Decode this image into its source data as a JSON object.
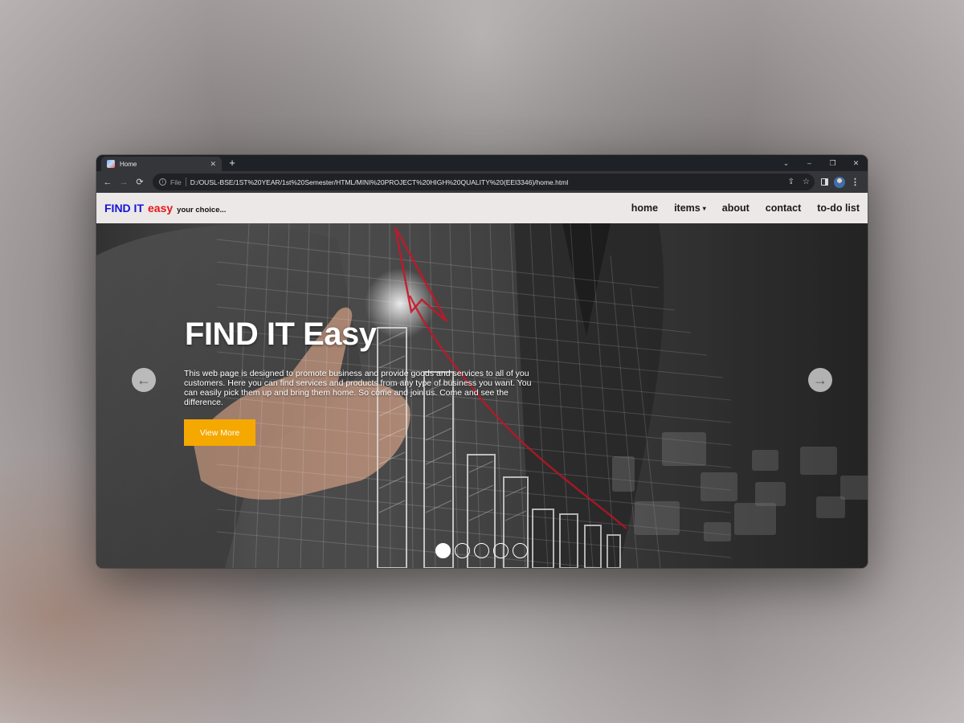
{
  "browser": {
    "tab_title": "Home",
    "tab_close": "✕",
    "new_tab": "+",
    "scheme_label": "File",
    "url": "D:/OUSL-BSE/1ST%20YEAR/1st%20Semester/HTML/MINI%20PROJECT%20HIGH%20QUALITY%20(EEI3346)/home.html",
    "window_controls": [
      "⌄",
      "–",
      "❐",
      "✕"
    ],
    "back": "←",
    "forward": "→",
    "reload": "⟳",
    "info": "i",
    "share_icon": "⇪",
    "star_icon": "☆",
    "menu": "⋮"
  },
  "site": {
    "logo_part1": "FIND IT",
    "logo_part2": "easy",
    "logo_part3": "your choice...",
    "brand_colors": {
      "blue": "#1414d8",
      "red": "#e4151a",
      "accent": "#f5a800"
    },
    "nav": {
      "home": "home",
      "items": "items",
      "items_caret": "▾",
      "about": "about",
      "contact": "contact",
      "todo": "to-do list"
    }
  },
  "hero": {
    "title": "FIND IT Easy",
    "text": "This web page is designed to promote business and provide goods and services to all of you customers. Here you can find services and products from any type of business you want. You can easily pick them up and bring them home. So come and join us. Come and see the difference.",
    "button": "View More",
    "prev_arrow": "←",
    "next_arrow": "→",
    "slide_count": 5,
    "active_slide": 1
  }
}
